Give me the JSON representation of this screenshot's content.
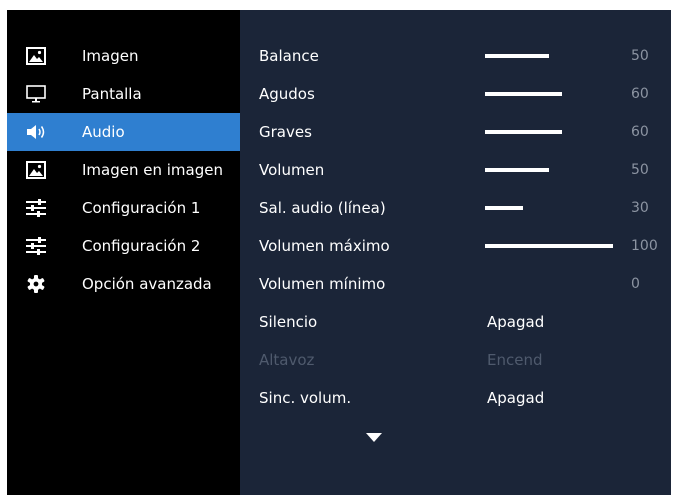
{
  "sidebar": {
    "items": [
      {
        "label": "Imagen",
        "icon": "image-icon",
        "active": false
      },
      {
        "label": "Pantalla",
        "icon": "monitor-icon",
        "active": false
      },
      {
        "label": "Audio",
        "icon": "speaker-icon",
        "active": true
      },
      {
        "label": "Imagen en imagen",
        "icon": "picture-in-picture-icon",
        "active": false
      },
      {
        "label": "Configuración 1",
        "icon": "sliders-icon",
        "active": false
      },
      {
        "label": "Configuración 2",
        "icon": "sliders-icon",
        "active": false
      },
      {
        "label": "Opción avanzada",
        "icon": "gear-icon",
        "active": false
      }
    ]
  },
  "audio": {
    "rows": [
      {
        "label": "Balance",
        "value": "50",
        "level": 0.5
      },
      {
        "label": "Agudos",
        "value": "60",
        "level": 0.6
      },
      {
        "label": "Graves",
        "value": "60",
        "level": 0.6
      },
      {
        "label": "Volumen",
        "value": "50",
        "level": 0.5
      },
      {
        "label": "Sal. audio (línea)",
        "value": "30",
        "level": 0.3
      },
      {
        "label": "Volumen máximo",
        "value": "100",
        "level": 1.0
      },
      {
        "label": "Volumen mínimo",
        "value": "0",
        "level": 0
      },
      {
        "label": "Silencio",
        "value": "Apagad"
      },
      {
        "label": "Altavoz",
        "value": "Encend",
        "disabled": true
      },
      {
        "label": "Sinc. volum.",
        "value": "Apagad"
      }
    ]
  },
  "icons": {
    "scroll_down": "chevron-down-icon"
  },
  "colors": {
    "accent": "#2f7fd0",
    "panel_background": "#1b2538",
    "sidebar_background": "#000000",
    "text": "#ffffff",
    "value_text": "#8c94a2",
    "disabled_text": "#4f5a6d"
  }
}
